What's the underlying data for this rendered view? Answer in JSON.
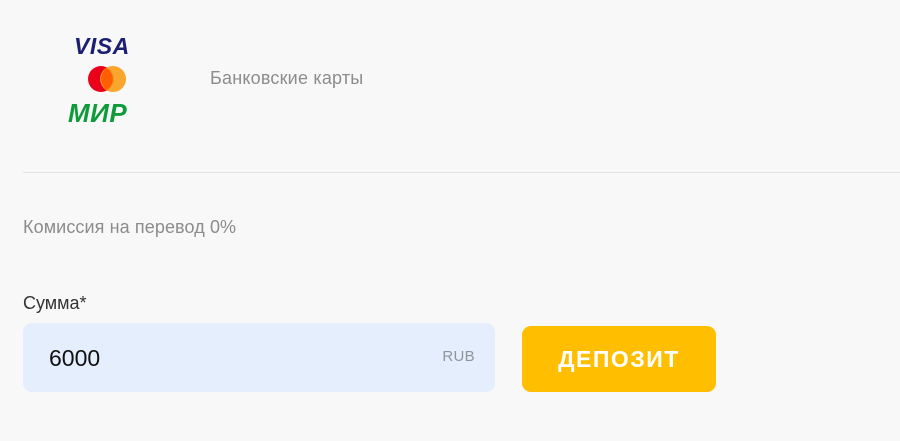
{
  "payment_method": {
    "name": "Банковские карты",
    "logos": {
      "visa": "VISA",
      "mastercard": "mastercard-logo",
      "mir": "МИР"
    }
  },
  "commission_text": "Комиссия на перевод 0%",
  "amount": {
    "label": "Сумма*",
    "value": "6000",
    "currency": "RUB"
  },
  "deposit_button": {
    "label": "ДЕПОЗИТ"
  },
  "colors": {
    "background": "#f8f8f8",
    "input_background": "#e4eefc",
    "button": "#ffbf00",
    "visa": "#1a1f71",
    "mc_red": "#eb001b",
    "mc_orange": "#f79e1b",
    "mir": "#0f9b3a"
  }
}
